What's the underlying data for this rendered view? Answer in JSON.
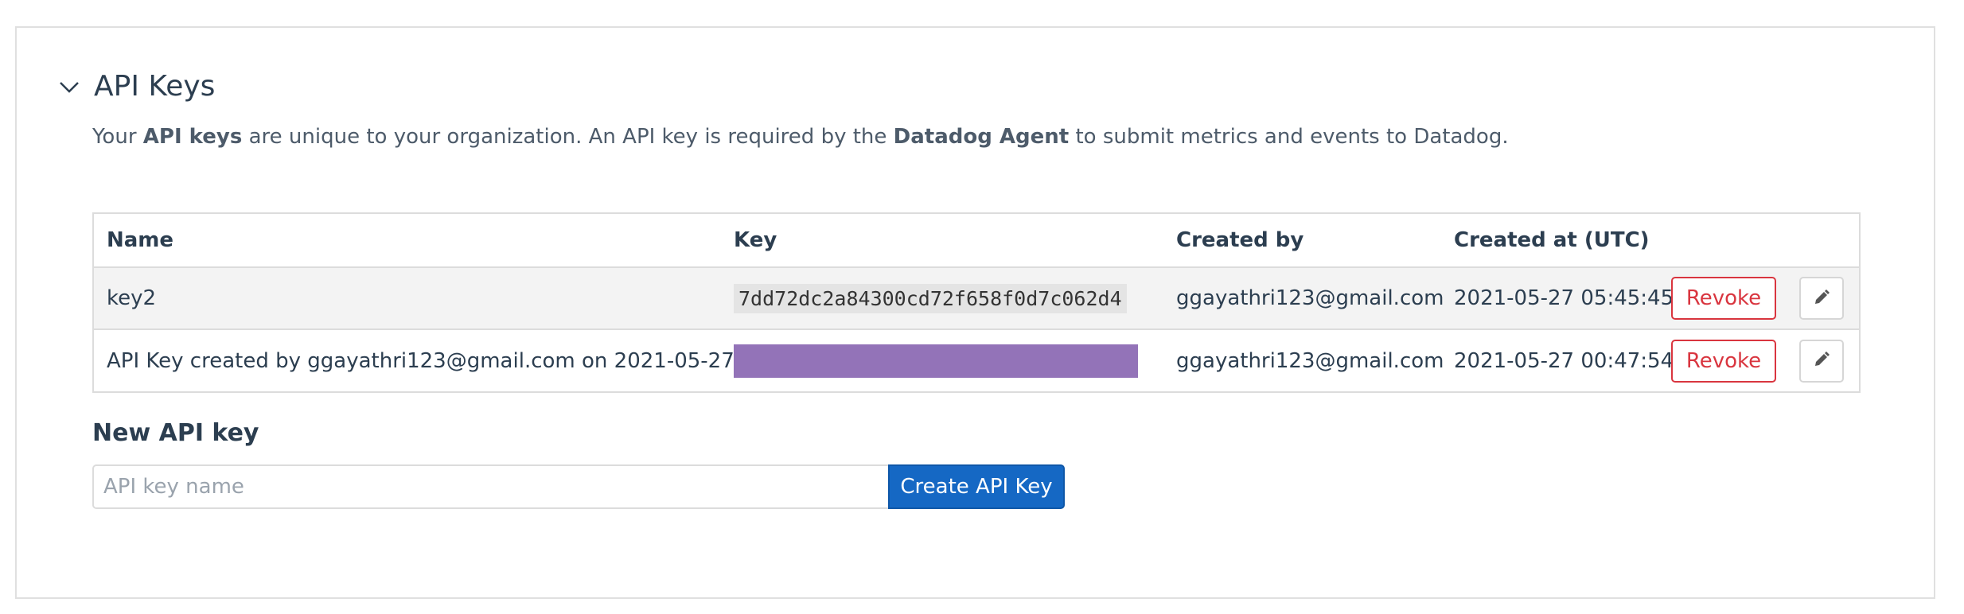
{
  "section": {
    "title": "API Keys",
    "description_parts": {
      "p1": "Your ",
      "b1": "API keys",
      "p2": " are unique to your organization. An API key is required by the ",
      "b2": "Datadog Agent",
      "p3": " to submit metrics and events to Datadog."
    }
  },
  "table": {
    "headers": [
      "Name",
      "Key",
      "Created by",
      "Created at (UTC)"
    ],
    "rows": [
      {
        "name": "key2",
        "key": "7dd72dc2a84300cd72f658f0d7c062d4",
        "created_by": "ggayathri123@gmail.com",
        "created_at": "2021-05-27 05:45:45",
        "revoke_label": "Revoke"
      },
      {
        "name": "API Key created by ggayathri123@gmail.com on 2021-05-27",
        "key": "",
        "created_by": "ggayathri123@gmail.com",
        "created_at": "2021-05-27 00:47:54",
        "revoke_label": "Revoke"
      }
    ]
  },
  "new_key": {
    "label": "New API key",
    "placeholder": "API key name",
    "value": "",
    "create_label": "Create API Key"
  },
  "icons": {
    "collapse": "chevron-down-icon",
    "edit": "pencil-icon"
  },
  "colors": {
    "revoke": "#d9353f",
    "primary": "#1568c4",
    "redacted": "#9373b8"
  }
}
